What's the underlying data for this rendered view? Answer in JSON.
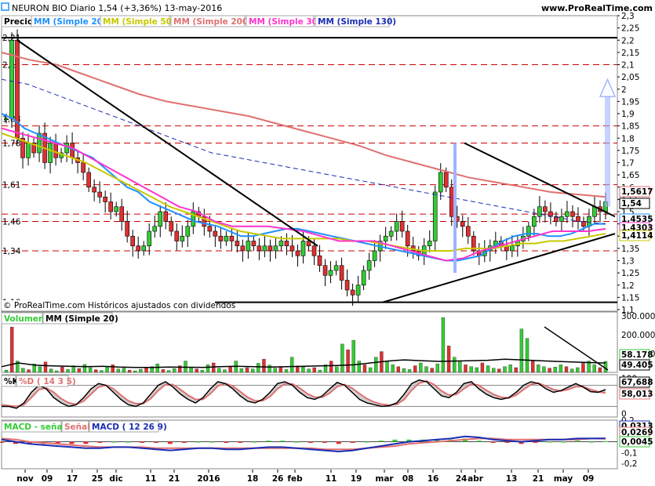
{
  "header": {
    "title": "NEURON BIO  Diario   1,54 (+3,36%)   13-may-2016",
    "site": "www.ProRealTime.com"
  },
  "colors": {
    "up": "#33cc33",
    "down": "#e03030",
    "ma20": "#1e90ff",
    "ma50": "#c8c800",
    "ma200": "#e07070",
    "ma30": "#ff33cc",
    "ma130": "#1a2cb4",
    "trend": "#000000",
    "hline": "#cc0000",
    "projection": "#a0b4ff"
  },
  "chart_data": [
    {
      "type": "line",
      "panel": "price",
      "legend": [
        "Precio",
        "MM (Simple 20)",
        "MM (Simple 50)",
        "MM (Simple 200)",
        "MM (Simple 30)",
        "MM (Simple 130)"
      ],
      "ylim": [
        1.1,
        2.3
      ],
      "y_ticks": [
        "2,3",
        "2,25",
        "2,2",
        "2,15",
        "2,1",
        "2,05",
        "2",
        "1,95",
        "1,9",
        "1,85",
        "1,8",
        "1,75",
        "1,7",
        "1,65",
        "1,6",
        "1,55",
        "1,5",
        "1,45",
        "1,4",
        "1,35",
        "1,3",
        "1,25",
        "1,2",
        "1,15",
        "1,1"
      ],
      "level_labels": [
        "2,21",
        "2,1",
        "1,88",
        "1,78",
        "1,61",
        "1,46",
        "1,34",
        "1,13"
      ],
      "levels": [
        2.21,
        2.1,
        1.85,
        1.78,
        1.61,
        1.49,
        1.46,
        1.34,
        1.13
      ],
      "right_tags": [
        {
          "text": "1,5617",
          "value": 1.5617,
          "color": "#e07070"
        },
        {
          "text": "1,54",
          "value": 1.54,
          "color": "#000000"
        },
        {
          "text": "1,4535",
          "value": 1.4535,
          "color": "#1e90ff"
        },
        {
          "text": "1,4303",
          "value": 1.4303,
          "color": "#ff33cc"
        },
        {
          "text": "1,4114",
          "value": 1.4114,
          "color": "#c8c800"
        }
      ],
      "footnote": "© ProRealTime.com  Históricos ajustados con dividendos",
      "closes": [
        1.88,
        2.2,
        1.8,
        1.72,
        1.78,
        1.74,
        1.82,
        1.7,
        1.78,
        1.72,
        1.74,
        1.78,
        1.72,
        1.7,
        1.66,
        1.6,
        1.58,
        1.56,
        1.54,
        1.5,
        1.52,
        1.46,
        1.4,
        1.36,
        1.34,
        1.36,
        1.42,
        1.44,
        1.5,
        1.46,
        1.42,
        1.38,
        1.4,
        1.44,
        1.5,
        1.48,
        1.44,
        1.42,
        1.4,
        1.38,
        1.4,
        1.38,
        1.36,
        1.34,
        1.38,
        1.36,
        1.34,
        1.36,
        1.34,
        1.36,
        1.38,
        1.36,
        1.34,
        1.32,
        1.38,
        1.36,
        1.32,
        1.28,
        1.24,
        1.26,
        1.28,
        1.22,
        1.18,
        1.16,
        1.2,
        1.26,
        1.3,
        1.34,
        1.38,
        1.4,
        1.42,
        1.46,
        1.42,
        1.36,
        1.34,
        1.32,
        1.36,
        1.38,
        1.58,
        1.66,
        1.6,
        1.48,
        1.46,
        1.44,
        1.4,
        1.34,
        1.32,
        1.34,
        1.36,
        1.38,
        1.36,
        1.34,
        1.36,
        1.38,
        1.4,
        1.44,
        1.48,
        1.52,
        1.5,
        1.48,
        1.46,
        1.48,
        1.5,
        1.48,
        1.46,
        1.44,
        1.48,
        1.52,
        1.5,
        1.54
      ],
      "series": [
        {
          "name": "MM (Simple 20)",
          "values": [
            1.9,
            1.88,
            1.84,
            1.82,
            1.8,
            1.78,
            1.76,
            1.74,
            1.72,
            1.68,
            1.64,
            1.6,
            1.58,
            1.54,
            1.52,
            1.5,
            1.48,
            1.46,
            1.45,
            1.44,
            1.42,
            1.4,
            1.4,
            1.41,
            1.42,
            1.43,
            1.43,
            1.42,
            1.41,
            1.4,
            1.39,
            1.38,
            1.37,
            1.36,
            1.35,
            1.34,
            1.33,
            1.32,
            1.31,
            1.3,
            1.3,
            1.31,
            1.32,
            1.35,
            1.38,
            1.4,
            1.41,
            1.41,
            1.4,
            1.4,
            1.41,
            1.43,
            1.45,
            1.45
          ]
        },
        {
          "name": "MM (Simple 50)",
          "values": [
            1.82,
            1.8,
            1.78,
            1.76,
            1.74,
            1.72,
            1.7,
            1.67,
            1.64,
            1.61,
            1.58,
            1.55,
            1.52,
            1.5,
            1.48,
            1.46,
            1.44,
            1.42,
            1.41,
            1.4,
            1.39,
            1.39,
            1.39,
            1.39,
            1.39,
            1.38,
            1.38,
            1.37,
            1.36,
            1.35,
            1.34,
            1.34,
            1.34,
            1.35,
            1.35,
            1.35,
            1.36,
            1.37,
            1.37,
            1.38,
            1.38,
            1.39,
            1.4,
            1.41
          ]
        },
        {
          "name": "MM (Simple 200)",
          "values": [
            2.15,
            2.12,
            2.1,
            2.06,
            2.02,
            1.98,
            1.95,
            1.93,
            1.91,
            1.89,
            1.86,
            1.83,
            1.8,
            1.77,
            1.73,
            1.7,
            1.67,
            1.64,
            1.62,
            1.6,
            1.58,
            1.57,
            1.56
          ]
        },
        {
          "name": "MM (Simple 30)",
          "values": [
            1.84,
            1.82,
            1.8,
            1.78,
            1.76,
            1.72,
            1.68,
            1.64,
            1.6,
            1.56,
            1.52,
            1.5,
            1.46,
            1.44,
            1.44,
            1.44,
            1.43,
            1.42,
            1.4,
            1.38,
            1.38,
            1.38,
            1.36,
            1.34,
            1.32,
            1.3,
            1.31,
            1.34,
            1.36,
            1.38,
            1.4,
            1.42,
            1.42,
            1.42,
            1.43
          ]
        },
        {
          "name": "MM (Simple 130)",
          "values": [
            2.04,
            2.02,
            1.98,
            1.94,
            1.9,
            1.86,
            1.82,
            1.78,
            1.74,
            1.72,
            1.7,
            1.68,
            1.66,
            1.64,
            1.62,
            1.6,
            1.58,
            1.56,
            1.54,
            1.52,
            1.5,
            1.48,
            1.46,
            1.45
          ]
        }
      ]
    },
    {
      "type": "bar",
      "panel": "volume",
      "legend": [
        "Volumen",
        "MM (Simple 20)"
      ],
      "y_ticks": [
        "300.000",
        "200.000",
        "100.000"
      ],
      "ylim": [
        0,
        320000
      ],
      "right_tags": [
        {
          "text": "58.178",
          "value": 58178,
          "color": "#33cc33"
        },
        {
          "text": "49.405",
          "value": 49405,
          "color": "#000000"
        }
      ],
      "values": [
        12000,
        240000,
        60000,
        22000,
        14000,
        45000,
        30000,
        55000,
        18000,
        8000,
        28000,
        15000,
        35000,
        20000,
        42000,
        25000,
        14000,
        10000,
        30000,
        40000,
        18000,
        22000,
        12000,
        8000,
        16000,
        25000,
        30000,
        45000,
        15000,
        10000,
        20000,
        35000,
        60000,
        28000,
        18000,
        12000,
        40000,
        50000,
        22000,
        14000,
        30000,
        60000,
        20000,
        25000,
        18000,
        48000,
        70000,
        38000,
        22000,
        30000,
        15000,
        80000,
        34000,
        28000,
        18000,
        25000,
        12000,
        40000,
        60000,
        30000,
        150000,
        120000,
        170000,
        60000,
        40000,
        25000,
        80000,
        110000,
        60000,
        40000,
        30000,
        20000,
        15000,
        35000,
        50000,
        30000,
        22000,
        45000,
        290000,
        140000,
        80000,
        60000,
        40000,
        30000,
        25000,
        50000,
        35000,
        22000,
        18000,
        30000,
        40000,
        25000,
        230000,
        180000,
        60000,
        40000,
        30000,
        22000,
        28000,
        40000,
        30000,
        18000,
        25000,
        48000,
        60000,
        40000,
        25000,
        58178
      ],
      "ma20": [
        30000,
        50000,
        38000,
        34000,
        32000,
        30000,
        32000,
        28000,
        26000,
        26000,
        28000,
        27000,
        26000,
        30000,
        32000,
        30000,
        28000,
        30000,
        32000,
        34000,
        36000,
        40000,
        50000,
        60000,
        66000,
        62000,
        58000,
        60000,
        62000,
        64000,
        70000,
        66000,
        62000,
        58000,
        55000,
        52000,
        49405
      ]
    },
    {
      "type": "line",
      "panel": "stochastic",
      "legend": [
        "%K",
        "%D ( 14 3 5)"
      ],
      "ylim": [
        -10,
        110
      ],
      "y_ticks": [
        "100",
        "50",
        "0"
      ],
      "right_tags": [
        {
          "text": "67,688",
          "value": 67.688,
          "color": "#000000"
        },
        {
          "text": "58,013",
          "value": 58.013,
          "color": "#e07070"
        }
      ],
      "k": [
        20,
        20,
        15,
        30,
        60,
        80,
        70,
        45,
        30,
        20,
        25,
        45,
        70,
        85,
        80,
        60,
        40,
        25,
        20,
        30,
        55,
        80,
        90,
        75,
        55,
        40,
        30,
        45,
        70,
        90,
        85,
        70,
        50,
        35,
        30,
        40,
        60,
        85,
        90,
        80,
        60,
        45,
        40,
        50,
        70,
        88,
        80,
        60,
        40,
        30,
        25,
        20,
        22,
        30,
        55,
        85,
        95,
        90,
        70,
        50,
        45,
        60,
        85,
        90,
        70,
        55,
        45,
        40,
        45,
        60,
        80,
        90,
        85,
        70,
        60,
        65,
        75,
        85,
        75,
        62,
        60,
        67.688
      ],
      "d": [
        25,
        22,
        20,
        25,
        45,
        68,
        72,
        60,
        42,
        30,
        26,
        35,
        55,
        75,
        80,
        70,
        52,
        36,
        28,
        28,
        42,
        65,
        82,
        82,
        68,
        52,
        40,
        40,
        56,
        78,
        85,
        78,
        62,
        46,
        36,
        36,
        48,
        70,
        84,
        84,
        72,
        56,
        46,
        46,
        58,
        76,
        82,
        72,
        56,
        42,
        32,
        26,
        24,
        26,
        40,
        66,
        86,
        92,
        82,
        64,
        52,
        54,
        70,
        84,
        80,
        66,
        54,
        46,
        44,
        52,
        68,
        82,
        86,
        78,
        68,
        64,
        68,
        76,
        76,
        68,
        62,
        58.013
      ]
    },
    {
      "type": "line",
      "panel": "macd",
      "legend": [
        "MACD - señal",
        "Señal",
        "MACD ( 12 26 9)"
      ],
      "ylim": [
        -0.25,
        0.2
      ],
      "y_ticks": [
        "0,2",
        "0,1",
        "0",
        "-0,1",
        "-0,2"
      ],
      "right_tags": [
        {
          "text": "0,0313",
          "value": 0.0313,
          "color": "#1a2cb4"
        },
        {
          "text": "0,0269",
          "value": 0.0269,
          "color": "#e07070"
        },
        {
          "text": "0,0045",
          "value": 0.0045,
          "color": "#33cc33"
        }
      ],
      "macd": [
        0.02,
        0.0,
        -0.02,
        -0.03,
        -0.04,
        -0.05,
        -0.06,
        -0.06,
        -0.05,
        -0.05,
        -0.06,
        -0.07,
        -0.08,
        -0.07,
        -0.06,
        -0.06,
        -0.07,
        -0.07,
        -0.06,
        -0.05,
        -0.05,
        -0.06,
        -0.07,
        -0.08,
        -0.09,
        -0.08,
        -0.06,
        -0.04,
        -0.02,
        0.0,
        0.01,
        0.02,
        0.03,
        0.05,
        0.04,
        0.02,
        0.01,
        0.0,
        0.01,
        0.02,
        0.02,
        0.03,
        0.03,
        0.0313
      ],
      "signal": [
        0.03,
        0.02,
        0.0,
        -0.01,
        -0.02,
        -0.03,
        -0.04,
        -0.05,
        -0.05,
        -0.05,
        -0.05,
        -0.06,
        -0.06,
        -0.06,
        -0.06,
        -0.06,
        -0.06,
        -0.06,
        -0.06,
        -0.06,
        -0.06,
        -0.06,
        -0.06,
        -0.07,
        -0.07,
        -0.07,
        -0.06,
        -0.05,
        -0.04,
        -0.02,
        -0.01,
        0.0,
        0.01,
        0.02,
        0.03,
        0.03,
        0.02,
        0.02,
        0.02,
        0.02,
        0.02,
        0.02,
        0.03,
        0.0269
      ]
    }
  ],
  "x_axis": {
    "labels": [
      "nov",
      "09",
      "17",
      "25",
      "dic",
      "11",
      "21",
      "2016",
      "18",
      "26",
      "feb",
      "11",
      "19",
      "mar",
      "08",
      "16",
      "24",
      "abr",
      "13",
      "21",
      "may",
      "09"
    ]
  }
}
